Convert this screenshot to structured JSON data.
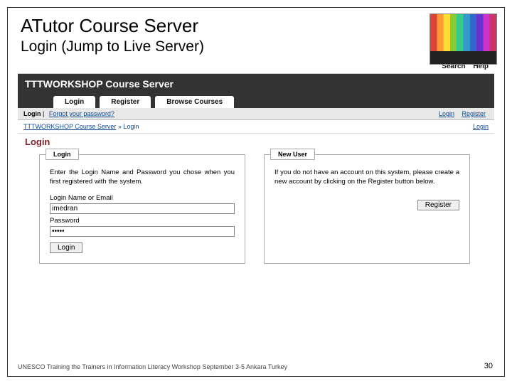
{
  "slide": {
    "title": "ATutor Course Server",
    "subtitle": "Login (Jump to Live Server)"
  },
  "topbar": {
    "search": "Search",
    "help": "Help"
  },
  "header": {
    "brand": "TTTWORKSHOP Course Server"
  },
  "tabs": {
    "login": "Login",
    "register": "Register",
    "browse": "Browse Courses"
  },
  "subbar": {
    "left_login": "Login",
    "forgot": "Forgot your password?",
    "right_login": "Login",
    "right_register": "Register"
  },
  "crumb": {
    "root": "TTTWORKSHOP Course Server",
    "sep": " » ",
    "current": "Login",
    "side_link": "Login"
  },
  "page_heading": "Login",
  "login_panel": {
    "legend": "Login",
    "text": "Enter the Login Name and Password you chose when you first registered with the system.",
    "name_label": "Login Name or Email",
    "name_value": "imedran",
    "pass_label": "Password",
    "pass_value": "•••••",
    "button": "Login"
  },
  "new_panel": {
    "legend": "New User",
    "text": "If you do not have an account on this system, please create a new account by clicking on the Register button below.",
    "button": "Register"
  },
  "footer": "UNESCO Training the Trainers in Information Literacy Workshop September 3-5 Ankara Turkey",
  "page_number": "30"
}
